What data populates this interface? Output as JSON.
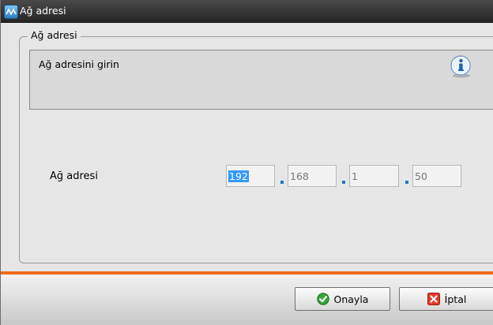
{
  "window": {
    "title": "Ağ adresi"
  },
  "group": {
    "legend": "Ağ adresi"
  },
  "info": {
    "text": "Ağ adresini girin",
    "icon": "info-icon"
  },
  "address": {
    "label": "Ağ adresi",
    "octets": [
      "192",
      "168",
      "1",
      "50"
    ],
    "selected_octet": 0
  },
  "buttons": {
    "confirm": {
      "label": "Onayla",
      "icon": "check-icon"
    },
    "cancel": {
      "label": "İptal",
      "icon": "cancel-icon"
    }
  },
  "colors": {
    "titlebar": "#262626",
    "accent_line": "#ec6b1e",
    "selection": "#3399ff",
    "dot": "#2a73c8"
  }
}
